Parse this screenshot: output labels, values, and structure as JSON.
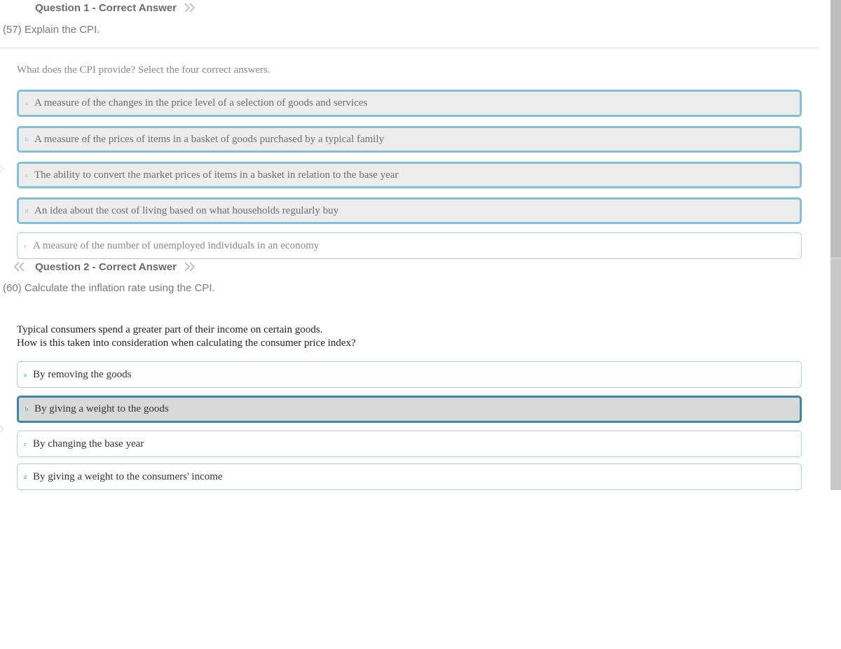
{
  "question1": {
    "header": "Question 1 - Correct Answer",
    "subtitle": "(57) Explain the CPI.",
    "prompt": "What does the CPI provide? Select the four correct answers.",
    "options": [
      {
        "letter": "a",
        "text": "A measure of the changes in the price level of a selection of goods and services"
      },
      {
        "letter": "b",
        "text": "A measure of the prices of items in a basket of goods purchased by a typical family"
      },
      {
        "letter": "c",
        "text": "The ability to convert the market prices of items in a basket in relation to the base year"
      },
      {
        "letter": "d",
        "text": "An idea about the cost of living based on what households regularly buy"
      },
      {
        "letter": "e",
        "text": "A measure of the number of unemployed individuals in an economy"
      }
    ]
  },
  "question2": {
    "header": "Question 2 - Correct Answer",
    "subtitle": "(60) Calculate the inflation rate using the CPI.",
    "prompt_lines": [
      "Typical consumers spend a greater part of their income on certain goods.",
      "How is this taken into consideration when calculating the consumer price index?"
    ],
    "options": [
      {
        "letter": "a",
        "text": "By removing the goods"
      },
      {
        "letter": "b",
        "text": "By giving a weight to the goods"
      },
      {
        "letter": "c",
        "text": "By changing the base year"
      },
      {
        "letter": "d",
        "text": "By giving a weight to the consumers' income"
      }
    ]
  },
  "colors": {
    "selected_border": "#86bdd8",
    "selected_strong_border": "#3c86a8",
    "plain_border": "#a8cfe6",
    "header_text": "#6b6b6b",
    "arrow": "#c4c4c4"
  },
  "icons": {
    "prev": "double-chevron-left-icon",
    "next": "double-chevron-right-icon"
  }
}
